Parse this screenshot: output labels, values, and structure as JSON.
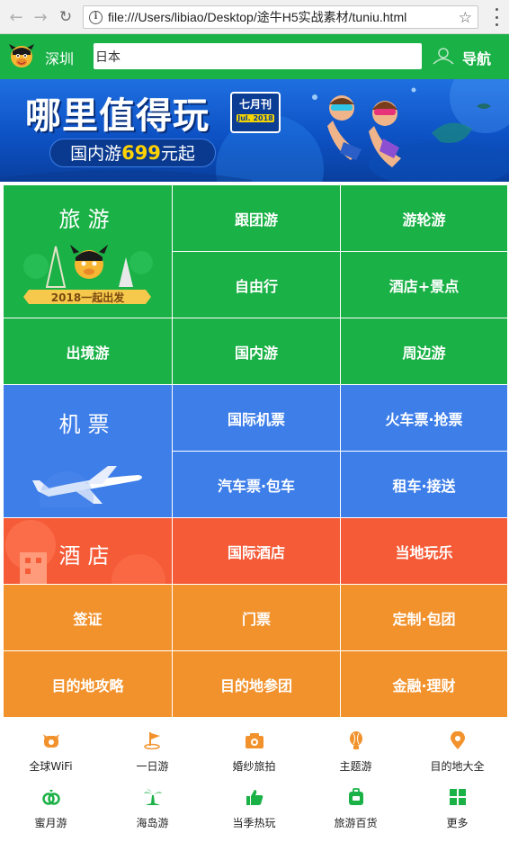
{
  "browser": {
    "url": "file:///Users/libiao/Desktop/途牛H5实战素材/tuniu.html"
  },
  "header": {
    "city": "深圳",
    "search_value": "日本",
    "nav_label": "导航"
  },
  "banner": {
    "title": "哪里值得玩",
    "badge_top": "七月刊",
    "badge_bottom": "Jul. 2018",
    "promo_prefix": "国内游",
    "promo_number": "699",
    "promo_suffix": "元起"
  },
  "grid": {
    "travel": {
      "title": "旅游",
      "ribbon": "2018一起出发",
      "items": [
        "跟团游",
        "游轮游",
        "自由行",
        "酒店+景点",
        "出境游",
        "国内游",
        "周边游"
      ]
    },
    "flight": {
      "title": "机票",
      "items": [
        "国际机票",
        "火车票·抢票",
        "汽车票·包车",
        "租车·接送"
      ]
    },
    "hotel": {
      "title": "酒店",
      "items": [
        "国际酒店",
        "当地玩乐"
      ]
    },
    "more": {
      "items": [
        "签证",
        "门票",
        "定制·包团",
        "目的地攻略",
        "目的地参团",
        "金融·理财"
      ]
    }
  },
  "quick_icons": [
    {
      "label": "全球WiFi",
      "icon": "wifi-cow-icon",
      "color": "#f2922c"
    },
    {
      "label": "一日游",
      "icon": "flag-icon",
      "color": "#f2922c"
    },
    {
      "label": "婚纱旅拍",
      "icon": "camera-icon",
      "color": "#f2922c"
    },
    {
      "label": "主题游",
      "icon": "balloon-icon",
      "color": "#f2922c"
    },
    {
      "label": "目的地大全",
      "icon": "location-pin-icon",
      "color": "#f2922c"
    },
    {
      "label": "蜜月游",
      "icon": "rings-icon",
      "color": "#1ab146"
    },
    {
      "label": "海岛游",
      "icon": "palm-tree-icon",
      "color": "#1ab146"
    },
    {
      "label": "当季热玩",
      "icon": "thumbs-up-icon",
      "color": "#1ab146"
    },
    {
      "label": "旅游百货",
      "icon": "suitcase-icon",
      "color": "#1ab146"
    },
    {
      "label": "更多",
      "icon": "grid-icon",
      "color": "#1ab146"
    }
  ],
  "colors": {
    "brand_green": "#1ab146",
    "flight_blue": "#3e7ee9",
    "hotel_red": "#f55b37",
    "service_orange": "#f2922c"
  }
}
